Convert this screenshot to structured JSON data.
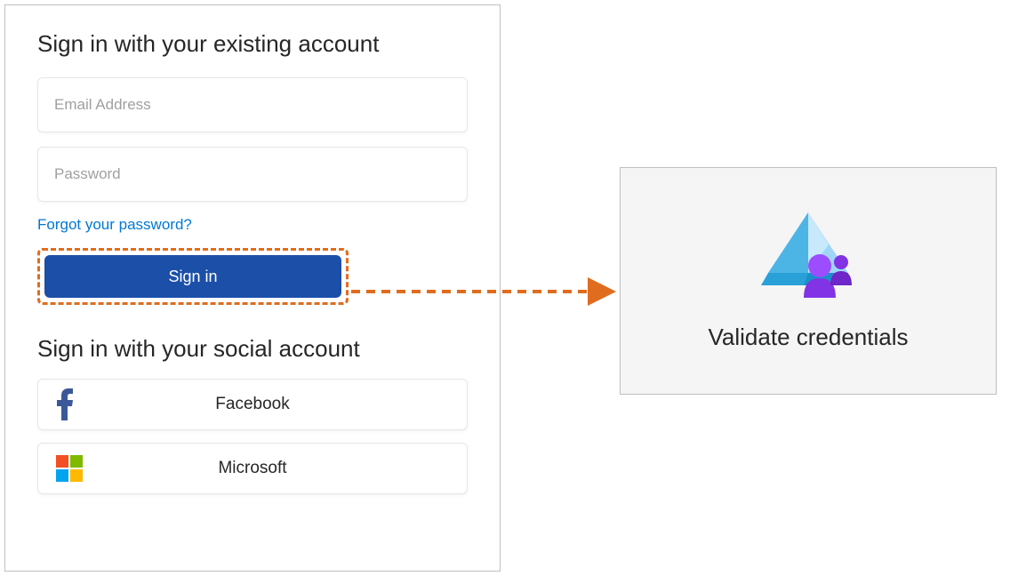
{
  "signin": {
    "heading": "Sign in with your existing account",
    "email_placeholder": "Email Address",
    "password_placeholder": "Password",
    "forgot_label": "Forgot your password?",
    "signin_button_label": "Sign in"
  },
  "social": {
    "heading": "Sign in with your social account",
    "facebook_label": "Facebook",
    "microsoft_label": "Microsoft"
  },
  "validate": {
    "label": "Validate credentials"
  },
  "colors": {
    "highlight_dash": "#e06c1f",
    "primary_button": "#1b4fa8",
    "link": "#0078d4"
  }
}
